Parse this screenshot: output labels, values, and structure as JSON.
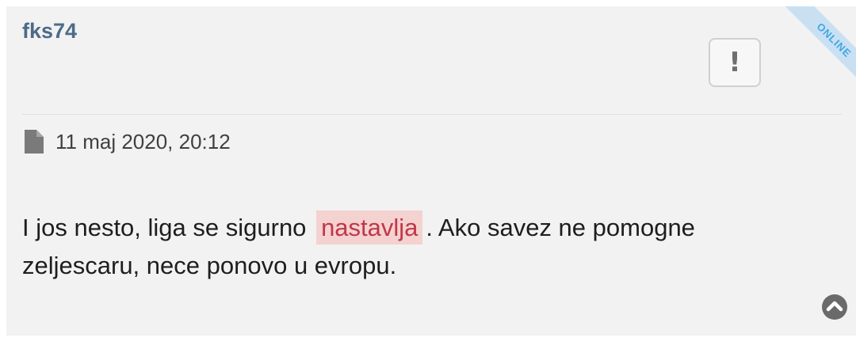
{
  "post": {
    "username": "fks74",
    "status_ribbon": "ONLINE",
    "report_symbol": "!",
    "timestamp": "11 maj 2020, 20:12",
    "text_before": "I jos nesto, liga se sigurno",
    "text_highlight": "nastavlja",
    "text_after": ". Ako savez ne pomogne zeljescaru, nece ponovo u evropu."
  },
  "icons": {
    "file": "file-icon",
    "report": "exclamation-icon",
    "scroll_up": "chevron-up-circle-icon"
  },
  "colors": {
    "username": "#4d6b88",
    "highlight_bg": "#f3d2cf",
    "highlight_text": "#c1364b",
    "ribbon_bg": "#c9e0f3",
    "ribbon_text": "#3ea7e3"
  }
}
